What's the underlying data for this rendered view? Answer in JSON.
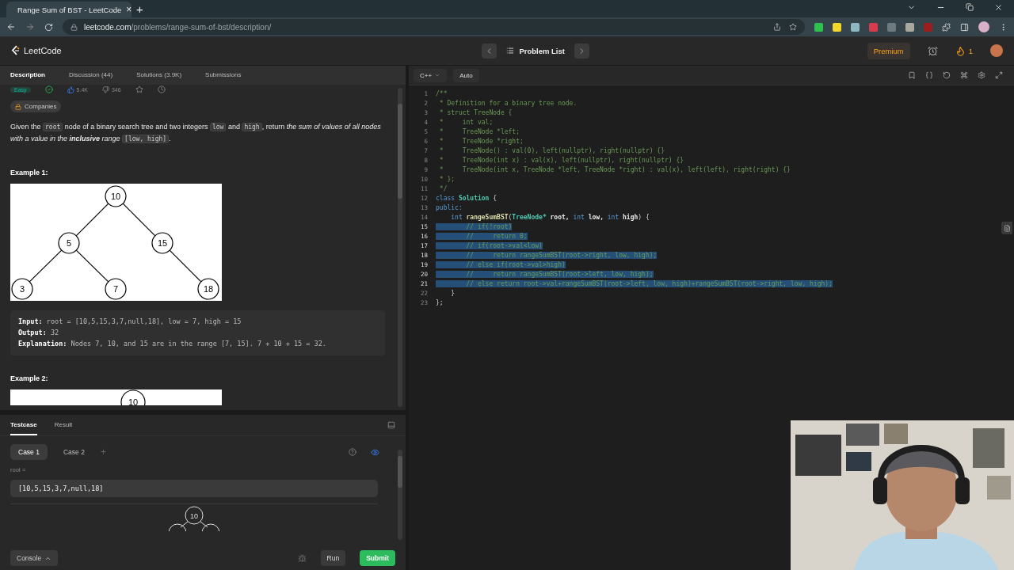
{
  "browser": {
    "tab_title": "Range Sum of BST - LeetCode",
    "tab_close": "×",
    "new_tab": "+",
    "url_host": "leetcode.com",
    "url_path": "/problems/range-sum-of-bst/description/"
  },
  "header": {
    "logo": "LeetCode",
    "problem_list": "Problem List",
    "premium": "Premium",
    "streak": "1"
  },
  "left_tabs": [
    {
      "label": "Description",
      "selected": true
    },
    {
      "label": "Discussion (44)",
      "selected": false
    },
    {
      "label": "Solutions (3.9K)",
      "selected": false
    },
    {
      "label": "Submissions",
      "selected": false
    }
  ],
  "meta": {
    "difficulty": "Easy",
    "likes": "5.4K",
    "dislikes": "346",
    "companies": "Companies"
  },
  "description": [
    {
      "text": "Given the ",
      "kind": "plain"
    },
    {
      "text": "root",
      "kind": "code"
    },
    {
      "text": " node of a binary search tree and two integers ",
      "kind": "plain"
    },
    {
      "text": "low",
      "kind": "code"
    },
    {
      "text": " and ",
      "kind": "plain"
    },
    {
      "text": "high",
      "kind": "code"
    },
    {
      "text": ", return ",
      "kind": "plain"
    },
    {
      "text": "the sum of values of all nodes with a value in the ",
      "kind": "italic"
    },
    {
      "text": "inclusive",
      "kind": "bolditalic"
    },
    {
      "text": " range ",
      "kind": "italic"
    },
    {
      "text": "[low, high]",
      "kind": "code"
    },
    {
      "text": ".",
      "kind": "plain"
    }
  ],
  "examples": [
    {
      "title": "Example 1:",
      "tree": [
        "10",
        "5",
        "15",
        "3",
        "7",
        "18"
      ],
      "lines": [
        {
          "label": "Input:",
          "text": " root = [10,5,15,3,7,null,18], low = 7, high = 15"
        },
        {
          "label": "Output:",
          "text": " 32"
        },
        {
          "label": "Explanation:",
          "text": " Nodes 7, 10, and 15 are in the range [7, 15]. 7 + 10 + 15 = 32."
        }
      ]
    },
    {
      "title": "Example 2:",
      "tree": [
        "10"
      ]
    }
  ],
  "testcase": {
    "tabs": [
      {
        "label": "Testcase",
        "selected": true
      },
      {
        "label": "Result",
        "selected": false
      }
    ],
    "cases": [
      {
        "label": "Case 1",
        "selected": true
      },
      {
        "label": "Case 2",
        "selected": false
      }
    ],
    "add": "+",
    "param_label": "root =",
    "param_value": "[10,5,15,3,7,null,18]",
    "tree_root": "10"
  },
  "footer": {
    "console": "Console",
    "run": "Run",
    "submit": "Submit"
  },
  "editor": {
    "language": "C++",
    "mode": "Auto",
    "lines": [
      {
        "n": "1",
        "selected": false,
        "tokens": [
          {
            "t": "/**",
            "kind": "comment"
          }
        ]
      },
      {
        "n": "2",
        "selected": false,
        "tokens": [
          {
            "t": " * Definition for a binary tree node.",
            "kind": "comment"
          }
        ]
      },
      {
        "n": "3",
        "selected": false,
        "tokens": [
          {
            "t": " * struct TreeNode {",
            "kind": "comment"
          }
        ]
      },
      {
        "n": "4",
        "selected": false,
        "tokens": [
          {
            "t": " *     int val;",
            "kind": "comment"
          }
        ]
      },
      {
        "n": "5",
        "selected": false,
        "tokens": [
          {
            "t": " *     TreeNode *left;",
            "kind": "comment"
          }
        ]
      },
      {
        "n": "6",
        "selected": false,
        "tokens": [
          {
            "t": " *     TreeNode *right;",
            "kind": "comment"
          }
        ]
      },
      {
        "n": "7",
        "selected": false,
        "tokens": [
          {
            "t": " *     TreeNode() : val(0), left(nullptr), right(nullptr) {}",
            "kind": "comment"
          }
        ]
      },
      {
        "n": "8",
        "selected": false,
        "tokens": [
          {
            "t": " *     TreeNode(int x) : val(x), left(nullptr), right(nullptr) {}",
            "kind": "comment"
          }
        ]
      },
      {
        "n": "9",
        "selected": false,
        "tokens": [
          {
            "t": " *     TreeNode(int x, TreeNode *left, TreeNode *right) : val(x), left(left), right(right) {}",
            "kind": "comment"
          }
        ]
      },
      {
        "n": "10",
        "selected": false,
        "tokens": [
          {
            "t": " * };",
            "kind": "comment"
          }
        ]
      },
      {
        "n": "11",
        "selected": false,
        "tokens": [
          {
            "t": " */",
            "kind": "comment"
          }
        ]
      },
      {
        "n": "12",
        "selected": false,
        "tokens": [
          {
            "t": "class ",
            "kind": "keyword"
          },
          {
            "t": "Solution",
            "kind": "type"
          },
          {
            "t": " {",
            "kind": "plain"
          }
        ]
      },
      {
        "n": "13",
        "selected": false,
        "tokens": [
          {
            "t": "public:",
            "kind": "keyword"
          }
        ]
      },
      {
        "n": "14",
        "selected": false,
        "tokens": [
          {
            "t": "    int ",
            "kind": "keyword"
          },
          {
            "t": "rangeSumBST",
            "kind": "function"
          },
          {
            "t": "(",
            "kind": "plain"
          },
          {
            "t": "TreeNode*",
            "kind": "type"
          },
          {
            "t": " root, ",
            "kind": "param"
          },
          {
            "t": "int ",
            "kind": "keyword"
          },
          {
            "t": "low, ",
            "kind": "param"
          },
          {
            "t": "int ",
            "kind": "keyword"
          },
          {
            "t": "high",
            "kind": "param"
          },
          {
            "t": ") {",
            "kind": "plain"
          }
        ]
      },
      {
        "n": "15",
        "selected": true,
        "tokens": [
          {
            "t": "        // if(!root)",
            "kind": "comment"
          }
        ]
      },
      {
        "n": "16",
        "selected": true,
        "tokens": [
          {
            "t": "        //     return 0;",
            "kind": "comment"
          }
        ]
      },
      {
        "n": "17",
        "selected": true,
        "tokens": [
          {
            "t": "        // if(root->val<low)",
            "kind": "comment"
          }
        ]
      },
      {
        "n": "18",
        "selected": true,
        "tokens": [
          {
            "t": "        //     return rangeSumBST(root->right, low, high);",
            "kind": "comment"
          }
        ]
      },
      {
        "n": "19",
        "selected": true,
        "tokens": [
          {
            "t": "        // else if(root->val>high)",
            "kind": "comment"
          }
        ]
      },
      {
        "n": "20",
        "selected": true,
        "tokens": [
          {
            "t": "        //     return rangeSumBST(root->left, low, high);",
            "kind": "comment"
          }
        ]
      },
      {
        "n": "21",
        "selected": true,
        "tokens": [
          {
            "t": "        // else return root->val+rangeSumBST(root->left, low, high)+rangeSumBST(root->right, low, high);",
            "kind": "comment"
          }
        ]
      },
      {
        "n": "22",
        "selected": false,
        "tokens": [
          {
            "t": "    }",
            "kind": "plain"
          }
        ]
      },
      {
        "n": "23",
        "selected": false,
        "tokens": [
          {
            "t": "};",
            "kind": "plain"
          }
        ]
      }
    ]
  }
}
